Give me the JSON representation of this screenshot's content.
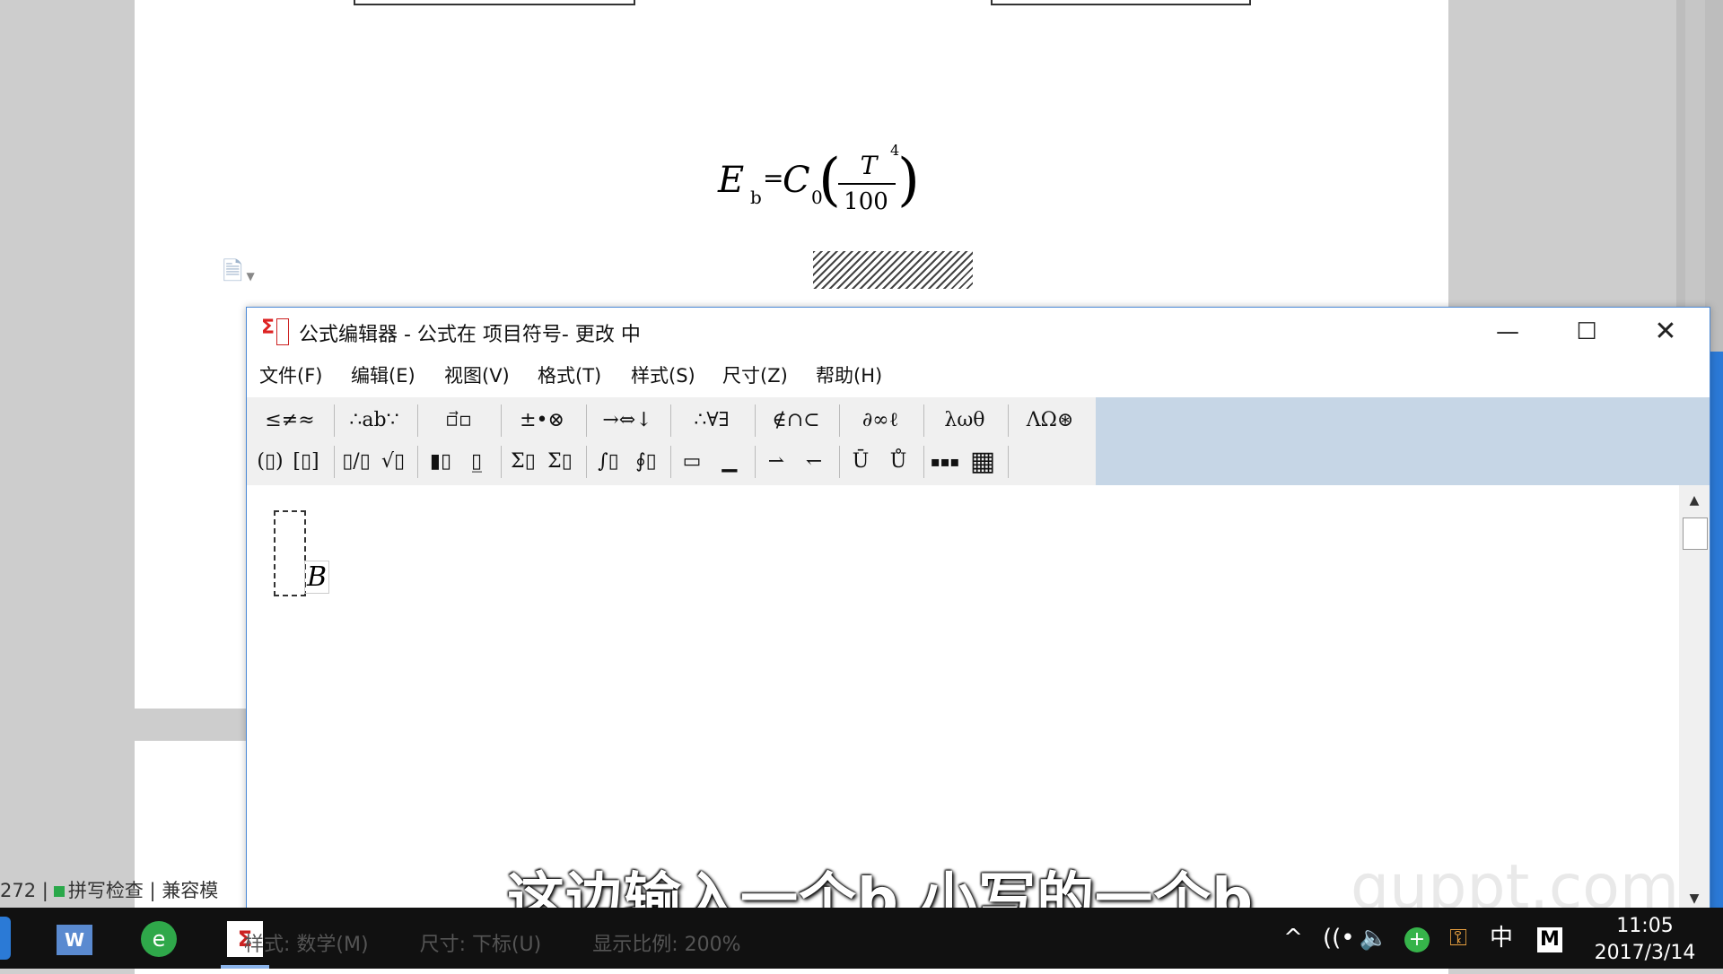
{
  "document": {
    "formula": {
      "E": "E",
      "sub_b": "b",
      "equals": "=",
      "C": "C",
      "sub_0": "0",
      "left_paren": "(",
      "numerator": "T",
      "denominator": "100",
      "right_paren": ")",
      "exponent": "4"
    },
    "status": {
      "count": "272",
      "spell_check": "拼写检查",
      "compat_mode": "兼容模"
    }
  },
  "editor": {
    "title": "公式编辑器 - 公式在 项目符号- 更改 中",
    "controls": {
      "minimize": "—",
      "maximize": "☐",
      "close": "✕"
    },
    "menu": [
      "文件(F)",
      "编辑(E)",
      "视图(V)",
      "格式(T)",
      "样式(S)",
      "尺寸(Z)",
      "帮助(H)"
    ],
    "toolbar_row1": [
      "≤≠≈",
      "∴ab∵",
      "▫⃗▫",
      "±•⊗",
      "→⇔↓",
      "∴∀∃",
      "∉∩⊂",
      "∂∞ℓ",
      "λωθ",
      "ΛΩ⊛"
    ],
    "toolbar_row2": [
      "(▯)",
      "[▯]",
      "▯/▯",
      "√▯",
      "▮▯",
      "▯̲",
      "Σ▯",
      "Σ▯",
      "∫▯",
      "∮▯",
      "▭",
      "▁",
      "⇀",
      "↽",
      "Ū",
      "Ů",
      "▪▪▪",
      "▦"
    ],
    "canvas": {
      "letter": "B"
    },
    "statusbar": {
      "style": "样式: 数学(M)",
      "size": "尺寸: 下标(U)",
      "zoom": "显示比例: 200%"
    }
  },
  "overlay": {
    "subtitle": "这边输入一个b 小写的一个b",
    "watermark": "quppt.com"
  },
  "taskbar": {
    "tray": {
      "chevron": "^",
      "network": "((•",
      "volume": "🔈",
      "plus": "+",
      "key": "⚿",
      "ime": "中",
      "m": "M"
    },
    "clock": {
      "time": "11:05",
      "date": "2017/3/14"
    }
  }
}
